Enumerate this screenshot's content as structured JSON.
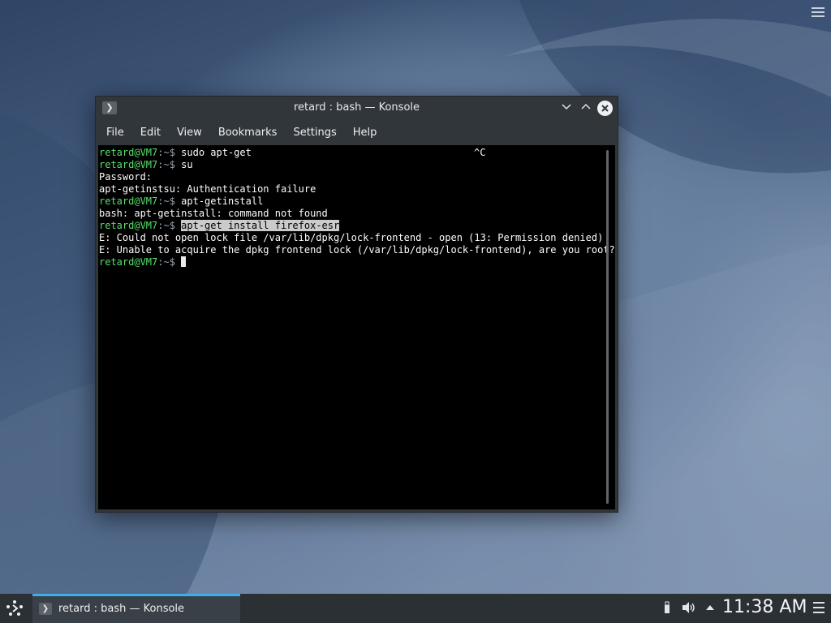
{
  "window": {
    "title": "retard : bash — Konsole",
    "menu": [
      "File",
      "Edit",
      "View",
      "Bookmarks",
      "Settings",
      "Help"
    ]
  },
  "terminal": {
    "prompt_user": "retard@VM7",
    "prompt_sep": ":~$",
    "lines": [
      {
        "type": "prompt",
        "cmd": "sudo apt-get",
        "ctrl": "^C"
      },
      {
        "type": "prompt",
        "cmd": "su"
      },
      {
        "type": "output",
        "text": "Password:"
      },
      {
        "type": "output",
        "text": "apt-getinstsu: Authentication failure"
      },
      {
        "type": "prompt",
        "cmd": "apt-getinstall"
      },
      {
        "type": "output",
        "text": "bash: apt-getinstall: command not found"
      },
      {
        "type": "prompt",
        "cmd": "apt-get install firefox-esr",
        "selected": true
      },
      {
        "type": "output",
        "text": "E: Could not open lock file /var/lib/dpkg/lock-frontend - open (13: Permission denied)"
      },
      {
        "type": "output",
        "text": "E: Unable to acquire the dpkg frontend lock (/var/lib/dpkg/lock-frontend), are you root?"
      },
      {
        "type": "prompt",
        "cmd": "",
        "cursor": true
      }
    ]
  },
  "taskbar": {
    "task_label": "retard : bash — Konsole",
    "clock": "11:38 AM",
    "accent_color": "#3daee9"
  },
  "icons": {
    "launcher": "application-launcher-icon",
    "terminal": "terminal-icon",
    "usb": "usb-device-icon",
    "volume": "volume-icon",
    "tray_expand": "chevron-up-icon",
    "desktop_menu": "hamburger-menu-icon"
  }
}
